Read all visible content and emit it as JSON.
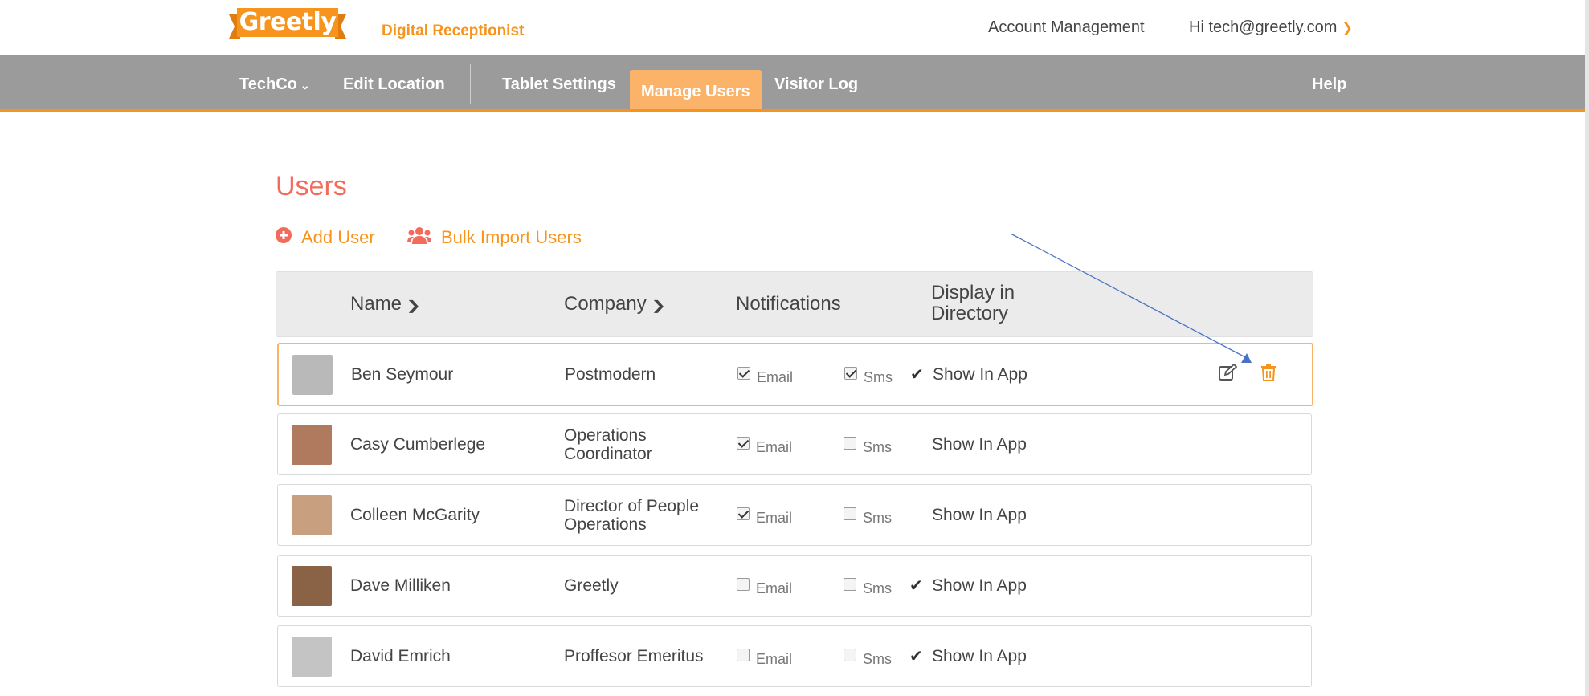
{
  "brand": {
    "logo_text": "Greetly",
    "tagline": "Digital Receptionist",
    "orange": "#f7941d",
    "title_red": "#f26b5b",
    "nav_gray": "#9b9b9b"
  },
  "header": {
    "account_management": "Account Management",
    "user_greeting": "Hi tech@greetly.com"
  },
  "nav": {
    "location_menu": "TechCo",
    "edit_location": "Edit Location",
    "tablet_settings": "Tablet Settings",
    "manage_users": "Manage Users",
    "visitor_log": "Visitor Log",
    "help": "Help"
  },
  "page": {
    "title": "Users",
    "add_user": "Add User",
    "bulk_import": "Bulk Import Users"
  },
  "table": {
    "headers": {
      "name": "Name",
      "company": "Company",
      "notifications": "Notifications",
      "display_line1": "Display in",
      "display_line2": "Directory"
    },
    "email_label": "Email",
    "sms_label": "Sms",
    "show_in_app": "Show In App",
    "rows": [
      {
        "name": "Ben Seymour",
        "company_line1": "Postmodern",
        "company_line2": "",
        "email": true,
        "sms": true,
        "show_in_app": true,
        "selected": true,
        "avatar": "#b9b9b9"
      },
      {
        "name": "Casy Cumberlege",
        "company_line1": "Operations",
        "company_line2": "Coordinator",
        "email": true,
        "sms": false,
        "show_in_app": false,
        "selected": false,
        "avatar": "#b07a5e"
      },
      {
        "name": "Colleen McGarity",
        "company_line1": "Director of People",
        "company_line2": "Operations",
        "email": true,
        "sms": false,
        "show_in_app": false,
        "selected": false,
        "avatar": "#c9a07f"
      },
      {
        "name": "Dave Milliken",
        "company_line1": "Greetly",
        "company_line2": "",
        "email": false,
        "sms": false,
        "show_in_app": true,
        "selected": false,
        "avatar": "#8a6246"
      },
      {
        "name": "David Emrich",
        "company_line1": "Proffesor Emeritus",
        "company_line2": "",
        "email": false,
        "sms": false,
        "show_in_app": true,
        "selected": false,
        "avatar": "#c4c4c4"
      }
    ]
  }
}
